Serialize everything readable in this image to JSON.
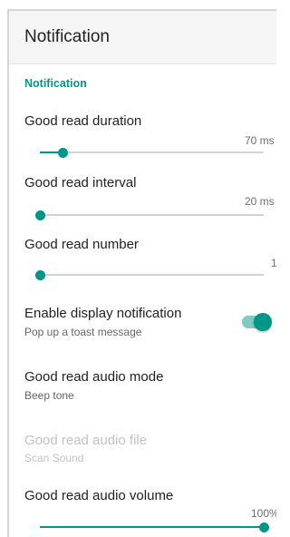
{
  "colors": {
    "accent": "#009688",
    "switch_on": "#009688"
  },
  "appbar": {
    "title": "Notification"
  },
  "section": {
    "header": "Notification"
  },
  "prefs": {
    "duration": {
      "title": "Good read duration",
      "value": "70 ms",
      "level": 0.1
    },
    "interval": {
      "title": "Good read interval",
      "value": "20 ms",
      "level": 0.0
    },
    "number": {
      "title": "Good read number",
      "value": "1",
      "level": 0.0
    },
    "display": {
      "title": "Enable display notification",
      "summary": "Pop up a toast message",
      "enabled": true
    },
    "audio_mode": {
      "title": "Good read audio mode",
      "summary": "Beep tone"
    },
    "audio_file": {
      "title": "Good read audio file",
      "summary": "Scan Sound"
    },
    "audio_volume": {
      "title": "Good read audio volume",
      "value": "100%",
      "level": 1.0
    }
  }
}
